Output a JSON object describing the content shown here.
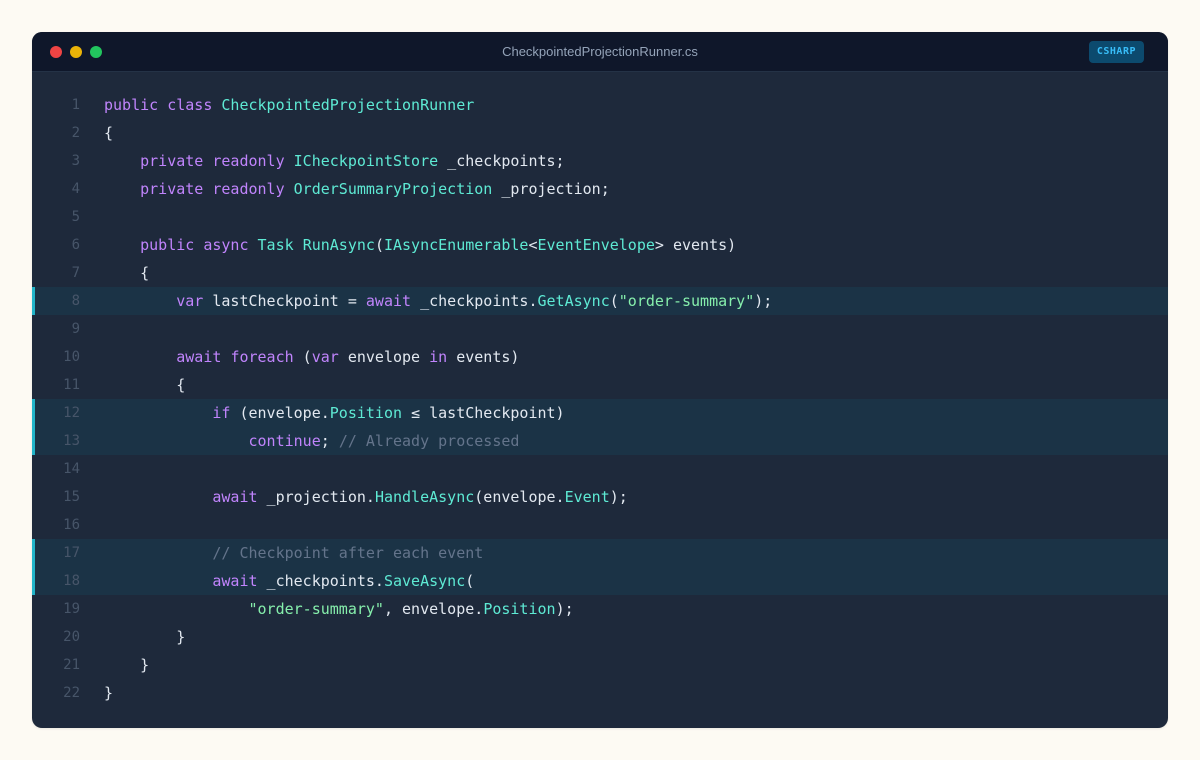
{
  "window": {
    "filename": "CheckpointedProjectionRunner.cs",
    "language": "CSHARP"
  },
  "colors": {
    "keyword": "#c084fc",
    "type": "#5eead4",
    "string": "#86efac",
    "comment": "#64748b",
    "text": "#e2e8f0",
    "highlight_bar": "#22b5c9"
  },
  "code": {
    "highlighted_lines": [
      8,
      12,
      13,
      17,
      18
    ],
    "lines": [
      {
        "n": "1",
        "tokens": [
          [
            "kw",
            "public"
          ],
          [
            "plain",
            " "
          ],
          [
            "kw",
            "class"
          ],
          [
            "plain",
            " "
          ],
          [
            "type",
            "CheckpointedProjectionRunner"
          ]
        ]
      },
      {
        "n": "2",
        "tokens": [
          [
            "plain",
            "{"
          ]
        ]
      },
      {
        "n": "3",
        "tokens": [
          [
            "plain",
            "    "
          ],
          [
            "kw",
            "private"
          ],
          [
            "plain",
            " "
          ],
          [
            "kw",
            "readonly"
          ],
          [
            "plain",
            " "
          ],
          [
            "type",
            "ICheckpointStore"
          ],
          [
            "plain",
            " _checkpoints;"
          ]
        ]
      },
      {
        "n": "4",
        "tokens": [
          [
            "plain",
            "    "
          ],
          [
            "kw",
            "private"
          ],
          [
            "plain",
            " "
          ],
          [
            "kw",
            "readonly"
          ],
          [
            "plain",
            " "
          ],
          [
            "type",
            "OrderSummaryProjection"
          ],
          [
            "plain",
            " _projection;"
          ]
        ]
      },
      {
        "n": "5",
        "tokens": []
      },
      {
        "n": "6",
        "tokens": [
          [
            "plain",
            "    "
          ],
          [
            "kw",
            "public"
          ],
          [
            "plain",
            " "
          ],
          [
            "kw",
            "async"
          ],
          [
            "plain",
            " "
          ],
          [
            "type",
            "Task"
          ],
          [
            "plain",
            " "
          ],
          [
            "type",
            "RunAsync"
          ],
          [
            "plain",
            "("
          ],
          [
            "type",
            "IAsyncEnumerable"
          ],
          [
            "plain",
            "<"
          ],
          [
            "type",
            "EventEnvelope"
          ],
          [
            "plain",
            "> events)"
          ]
        ]
      },
      {
        "n": "7",
        "tokens": [
          [
            "plain",
            "    {"
          ]
        ]
      },
      {
        "n": "8",
        "tokens": [
          [
            "plain",
            "        "
          ],
          [
            "kw",
            "var"
          ],
          [
            "plain",
            " lastCheckpoint = "
          ],
          [
            "kw",
            "await"
          ],
          [
            "plain",
            " _checkpoints."
          ],
          [
            "member",
            "GetAsync"
          ],
          [
            "plain",
            "("
          ],
          [
            "string",
            "\"order-summary\""
          ],
          [
            "plain",
            ");"
          ]
        ]
      },
      {
        "n": "9",
        "tokens": []
      },
      {
        "n": "10",
        "tokens": [
          [
            "plain",
            "        "
          ],
          [
            "kw",
            "await"
          ],
          [
            "plain",
            " "
          ],
          [
            "kw",
            "foreach"
          ],
          [
            "plain",
            " ("
          ],
          [
            "kw",
            "var"
          ],
          [
            "plain",
            " envelope "
          ],
          [
            "kw",
            "in"
          ],
          [
            "plain",
            " events)"
          ]
        ]
      },
      {
        "n": "11",
        "tokens": [
          [
            "plain",
            "        {"
          ]
        ]
      },
      {
        "n": "12",
        "tokens": [
          [
            "plain",
            "            "
          ],
          [
            "kw",
            "if"
          ],
          [
            "plain",
            " (envelope."
          ],
          [
            "member",
            "Position"
          ],
          [
            "plain",
            " ≤ lastCheckpoint)"
          ]
        ]
      },
      {
        "n": "13",
        "tokens": [
          [
            "plain",
            "                "
          ],
          [
            "kw",
            "continue"
          ],
          [
            "plain",
            "; "
          ],
          [
            "comment",
            "// Already processed"
          ]
        ]
      },
      {
        "n": "14",
        "tokens": []
      },
      {
        "n": "15",
        "tokens": [
          [
            "plain",
            "            "
          ],
          [
            "kw",
            "await"
          ],
          [
            "plain",
            " _projection."
          ],
          [
            "member",
            "HandleAsync"
          ],
          [
            "plain",
            "(envelope."
          ],
          [
            "member",
            "Event"
          ],
          [
            "plain",
            ");"
          ]
        ]
      },
      {
        "n": "16",
        "tokens": []
      },
      {
        "n": "17",
        "tokens": [
          [
            "plain",
            "            "
          ],
          [
            "comment",
            "// Checkpoint after each event"
          ]
        ]
      },
      {
        "n": "18",
        "tokens": [
          [
            "plain",
            "            "
          ],
          [
            "kw",
            "await"
          ],
          [
            "plain",
            " _checkpoints."
          ],
          [
            "member",
            "SaveAsync"
          ],
          [
            "plain",
            "("
          ]
        ]
      },
      {
        "n": "19",
        "tokens": [
          [
            "plain",
            "                "
          ],
          [
            "string",
            "\"order-summary\""
          ],
          [
            "plain",
            ", envelope."
          ],
          [
            "member",
            "Position"
          ],
          [
            "plain",
            ");"
          ]
        ]
      },
      {
        "n": "20",
        "tokens": [
          [
            "plain",
            "        }"
          ]
        ]
      },
      {
        "n": "21",
        "tokens": [
          [
            "plain",
            "    }"
          ]
        ]
      },
      {
        "n": "22",
        "tokens": [
          [
            "plain",
            "}"
          ]
        ]
      }
    ]
  }
}
